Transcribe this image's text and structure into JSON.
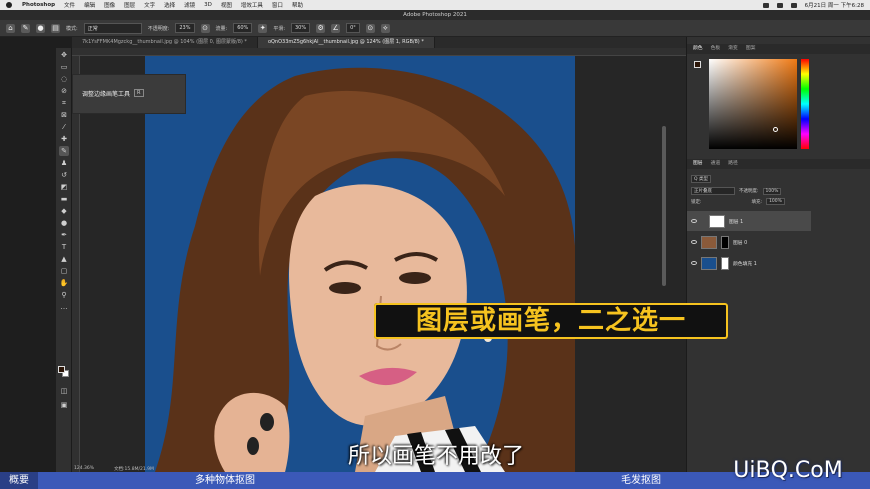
{
  "menubar": {
    "app_name": "Photoshop",
    "items": [
      "文件",
      "编辑",
      "图像",
      "图层",
      "文字",
      "选择",
      "滤镜",
      "3D",
      "视图",
      "增效工具",
      "窗口",
      "帮助"
    ],
    "clock": "6月21日 周一 下午6:28"
  },
  "window": {
    "title": "Adobe Photoshop 2021"
  },
  "options": {
    "mode_label": "模式:",
    "mode_value": "正常",
    "opacity_label": "不透明度:",
    "opacity_value": "23%",
    "flow_label": "流量:",
    "flow_value": "60%",
    "smooth_label": "平滑:",
    "smooth_value": "30%",
    "angle_value": "0°"
  },
  "tabs": [
    {
      "label": "7k1YsFFMK4Mgzckg__thumbnail.jpg @ 104% (图层 0, 图层蒙版/8) *",
      "active": false
    },
    {
      "label": "oQnO33mZ5g6hkjAl__thumbnail.jpg @ 124% (图层 1, RGB/8) *",
      "active": true
    }
  ],
  "tooltip": {
    "text": "调整边缘画笔工具",
    "shortcut": "R"
  },
  "panels": {
    "color_tabs": [
      "颜色",
      "色板",
      "渐变",
      "图案"
    ],
    "layer_tabs": [
      "图层",
      "通道",
      "路径"
    ],
    "kind_label": "Q 类型",
    "blend_mode": "正片叠底",
    "opacity_label": "不透明度:",
    "opacity_value": "100%",
    "lock_label": "锁定:",
    "fill_label": "填充:",
    "fill_value": "100%",
    "layers": [
      {
        "name": "图层 1",
        "selected": true
      },
      {
        "name": "图层 0",
        "selected": false
      },
      {
        "name": "颜色填充 1",
        "selected": false
      }
    ]
  },
  "captions": {
    "banner": "图层或画笔，二之选一",
    "subtitle": "所以画笔不用改了"
  },
  "status": {
    "zoom": "124.36%",
    "doc": "文档:15.8M/21.9M"
  },
  "videobar": {
    "left": "概要",
    "mid": "多种物体抠图",
    "right": "毛发抠图"
  },
  "watermark": "UiBQ.CoM",
  "colors": {
    "photo_background": "#1a4f8d",
    "foreground_swatch": "#2c1608",
    "banner_text": "#f6c31f",
    "videobar": "#3b59b8"
  }
}
